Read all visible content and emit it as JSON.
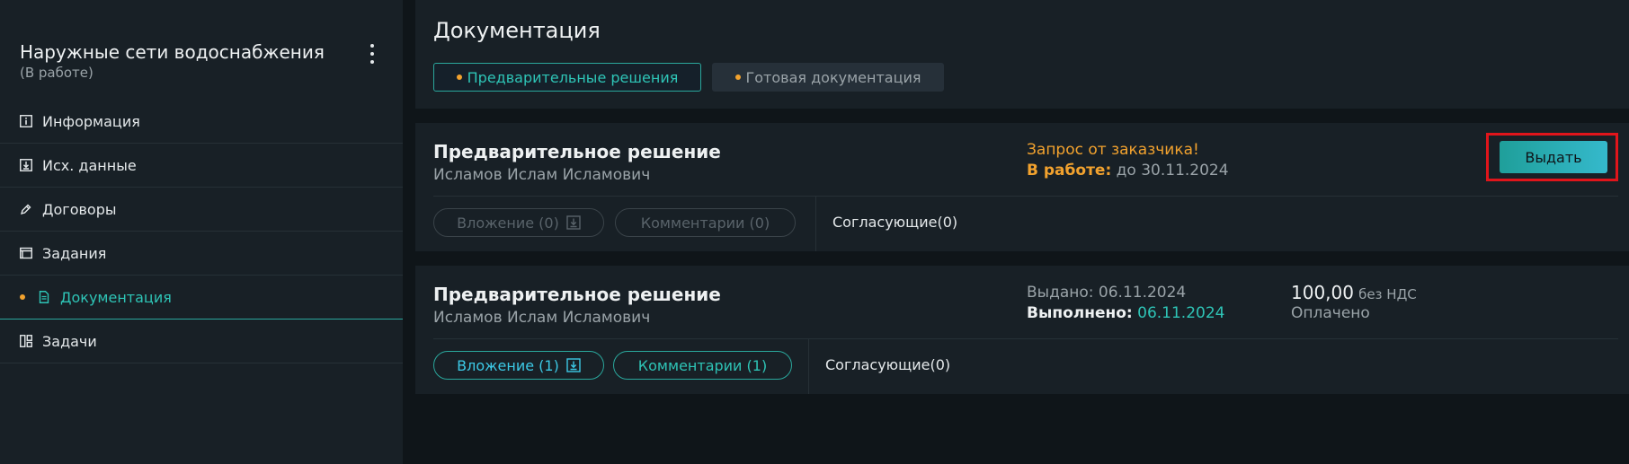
{
  "sidebar": {
    "project_title": "Наружные сети водоснабжения",
    "project_status": "(В работе)",
    "items": [
      {
        "label": "Информация",
        "icon": "info-icon"
      },
      {
        "label": "Исх. данные",
        "icon": "download-icon"
      },
      {
        "label": "Договоры",
        "icon": "pen-icon"
      },
      {
        "label": "Задания",
        "icon": "window-icon"
      },
      {
        "label": "Документация",
        "icon": "document-icon",
        "active": true
      },
      {
        "label": "Задачи",
        "icon": "board-icon"
      }
    ]
  },
  "docs": {
    "title": "Документация",
    "tabs": [
      {
        "label": "Предварительные решения",
        "active": true
      },
      {
        "label": "Готовая документация",
        "active": false
      }
    ]
  },
  "cards": [
    {
      "title": "Предварительное решение",
      "person": "Исламов Ислам Исламович",
      "alert": "Запрос от заказчика!",
      "status_label": "В работе:",
      "status_value": "до 30.11.2024",
      "action_label": "Выдать",
      "attachments_label": "Вложение (0)",
      "comments_label": "Комментарии (0)",
      "approvers_label": "Согласующие(0)"
    },
    {
      "title": "Предварительное решение",
      "person": "Исламов Ислам Исламович",
      "issued": "Выдано: 06.11.2024",
      "done_label": "Выполнено:",
      "done_date": "06.11.2024",
      "price": "100,00",
      "price_note": "без НДС",
      "payment_status": "Оплачено",
      "attachments_label": "Вложение (1)",
      "comments_label": "Комментарии (1)",
      "approvers_label": "Согласующие(0)"
    }
  ],
  "colors": {
    "accent_teal": "#2ec4b6",
    "accent_orange": "#f2a22e",
    "highlight_red": "#e0151b",
    "panel": "#182026",
    "background": "#0f1519"
  }
}
